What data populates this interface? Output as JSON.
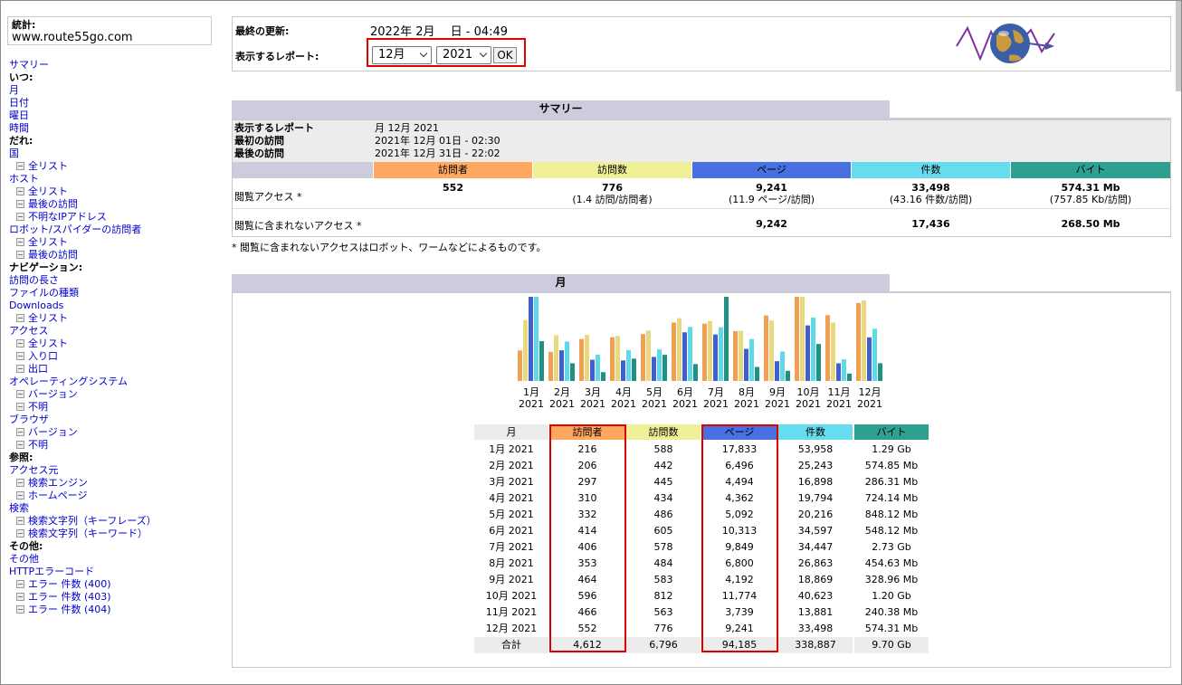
{
  "sidebar": {
    "stat_label": "統計:",
    "site": "www.route55go.com",
    "items": [
      {
        "label": "サマリー",
        "kind": "lnk"
      },
      {
        "label": "いつ:",
        "kind": "hdr"
      },
      {
        "label": "月",
        "kind": "lnk"
      },
      {
        "label": "日付",
        "kind": "lnk"
      },
      {
        "label": "曜日",
        "kind": "lnk"
      },
      {
        "label": "時間",
        "kind": "lnk"
      },
      {
        "label": "だれ:",
        "kind": "hdr"
      },
      {
        "label": "国",
        "kind": "lnk"
      },
      {
        "label": "全リスト",
        "kind": "sub"
      },
      {
        "label": "ホスト",
        "kind": "lnk"
      },
      {
        "label": "全リスト",
        "kind": "sub"
      },
      {
        "label": "最後の訪問",
        "kind": "sub"
      },
      {
        "label": "不明なIPアドレス",
        "kind": "sub"
      },
      {
        "label": "ロボット/スパイダーの訪問者",
        "kind": "lnk"
      },
      {
        "label": "全リスト",
        "kind": "sub"
      },
      {
        "label": "最後の訪問",
        "kind": "sub"
      },
      {
        "label": "ナビゲーション:",
        "kind": "hdr"
      },
      {
        "label": "訪問の長さ",
        "kind": "lnk"
      },
      {
        "label": "ファイルの種類",
        "kind": "lnk"
      },
      {
        "label": "Downloads",
        "kind": "lnk"
      },
      {
        "label": "全リスト",
        "kind": "sub"
      },
      {
        "label": "アクセス",
        "kind": "lnk"
      },
      {
        "label": "全リスト",
        "kind": "sub"
      },
      {
        "label": "入り口",
        "kind": "sub"
      },
      {
        "label": "出口",
        "kind": "sub"
      },
      {
        "label": "オペレーティングシステム",
        "kind": "lnk"
      },
      {
        "label": "バージョン",
        "kind": "sub"
      },
      {
        "label": "不明",
        "kind": "sub"
      },
      {
        "label": "ブラウザ",
        "kind": "lnk"
      },
      {
        "label": "バージョン",
        "kind": "sub"
      },
      {
        "label": "不明",
        "kind": "sub"
      },
      {
        "label": "参照:",
        "kind": "hdr"
      },
      {
        "label": "アクセス元",
        "kind": "lnk"
      },
      {
        "label": "検索エンジン",
        "kind": "sub"
      },
      {
        "label": "ホームページ",
        "kind": "sub"
      },
      {
        "label": "検索",
        "kind": "lnk"
      },
      {
        "label": "検索文字列（キーフレーズ）",
        "kind": "sub"
      },
      {
        "label": "検索文字列（キーワード）",
        "kind": "sub"
      },
      {
        "label": "その他:",
        "kind": "hdr"
      },
      {
        "label": "その他",
        "kind": "lnk"
      },
      {
        "label": "HTTPエラーコード",
        "kind": "lnk"
      },
      {
        "label": "エラー 件数 (400)",
        "kind": "sub"
      },
      {
        "label": "エラー 件数 (403)",
        "kind": "sub"
      },
      {
        "label": "エラー 件数 (404)",
        "kind": "sub"
      }
    ]
  },
  "top": {
    "last_update_label": "最終の更新:",
    "last_update_value": "2022年 2月　 日 - 04:49",
    "report_label": "表示するレポート:",
    "month_select": "12月",
    "year_select": "2021",
    "ok_label": "OK"
  },
  "summary": {
    "title": "サマリー",
    "report_key": "表示するレポート",
    "report_val": "月 12月 2021",
    "first_key": "最初の訪問",
    "first_val": "2021年 12月 01日 - 02:30",
    "last_key": "最後の訪問",
    "last_val": "2021年 12月 31日 - 22:02",
    "headers": [
      "訪問者",
      "訪問数",
      "ページ",
      "件数",
      "バイト"
    ],
    "row1_label": "閲覧アクセス *",
    "row1": [
      {
        "main": "552",
        "sub": ""
      },
      {
        "main": "776",
        "sub": "(1.4 訪問/訪問者)"
      },
      {
        "main": "9,241",
        "sub": "(11.9 ページ/訪問)"
      },
      {
        "main": "33,498",
        "sub": "(43.16 件数/訪問)"
      },
      {
        "main": "574.31 Mb",
        "sub": "(757.85 Kb/訪問)"
      }
    ],
    "row2_label": "閲覧に含まれないアクセス *",
    "row2": [
      "",
      "",
      "9,242",
      "17,436",
      "268.50 Mb"
    ],
    "footnote": "* 閲覧に含まれないアクセスはロボット、ワームなどによるものです。"
  },
  "month": {
    "title": "月",
    "table_headers": [
      "月",
      "訪問者",
      "訪問数",
      "ページ",
      "件数",
      "バイト"
    ],
    "rows": [
      [
        "1月 2021",
        "216",
        "588",
        "17,833",
        "53,958",
        "1.29 Gb"
      ],
      [
        "2月 2021",
        "206",
        "442",
        "6,496",
        "25,243",
        "574.85 Mb"
      ],
      [
        "3月 2021",
        "297",
        "445",
        "4,494",
        "16,898",
        "286.31 Mb"
      ],
      [
        "4月 2021",
        "310",
        "434",
        "4,362",
        "19,794",
        "724.14 Mb"
      ],
      [
        "5月 2021",
        "332",
        "486",
        "5,092",
        "20,216",
        "848.12 Mb"
      ],
      [
        "6月 2021",
        "414",
        "605",
        "10,313",
        "34,597",
        "548.12 Mb"
      ],
      [
        "7月 2021",
        "406",
        "578",
        "9,849",
        "34,447",
        "2.73 Gb"
      ],
      [
        "8月 2021",
        "353",
        "484",
        "6,800",
        "26,863",
        "454.63 Mb"
      ],
      [
        "9月 2021",
        "464",
        "583",
        "4,192",
        "18,869",
        "328.96 Mb"
      ],
      [
        "10月 2021",
        "596",
        "812",
        "11,774",
        "40,623",
        "1.20 Gb"
      ],
      [
        "11月 2021",
        "466",
        "563",
        "3,739",
        "13,881",
        "240.38 Mb"
      ],
      [
        "12月 2021",
        "552",
        "776",
        "9,241",
        "33,498",
        "574.31 Mb"
      ]
    ],
    "total": [
      "合計",
      "4,612",
      "6,796",
      "94,185",
      "338,887",
      "9.70 Gb"
    ]
  },
  "chart_data": {
    "type": "bar",
    "categories": [
      "1月",
      "2月",
      "3月",
      "4月",
      "5月",
      "6月",
      "7月",
      "8月",
      "9月",
      "10月",
      "11月",
      "12月"
    ],
    "year_labels": [
      "2021",
      "2021",
      "2021",
      "2021",
      "2021",
      "2021",
      "2021",
      "2021",
      "2021",
      "2021",
      "2021",
      "2021"
    ],
    "series": [
      {
        "values": [
          216,
          206,
          297,
          310,
          332,
          414,
          406,
          353,
          464,
          596,
          466,
          552
        ],
        "color": "#f0a050"
      },
      {
        "values": [
          588,
          442,
          445,
          434,
          486,
          605,
          578,
          484,
          583,
          812,
          563,
          776
        ],
        "color": "#e8d880"
      },
      {
        "values": [
          17833,
          6496,
          4494,
          4362,
          5092,
          10313,
          9849,
          6800,
          4192,
          11774,
          3739,
          9241
        ],
        "color": "#4060d0"
      },
      {
        "values": [
          53958,
          25243,
          16898,
          19794,
          20216,
          34597,
          34447,
          26863,
          18869,
          40623,
          13881,
          33498
        ],
        "color": "#60d8e8"
      },
      {
        "values": [
          1.29,
          0.574,
          0.286,
          0.724,
          0.848,
          0.548,
          2.73,
          0.455,
          0.329,
          1.2,
          0.24,
          0.574
        ],
        "color": "#209080"
      }
    ],
    "colors": {
      "visitors": "#ffa860",
      "visits": "#f0f098",
      "pages": "#4870e0",
      "hits": "#66ddee",
      "bytes": "#2ea090"
    }
  }
}
